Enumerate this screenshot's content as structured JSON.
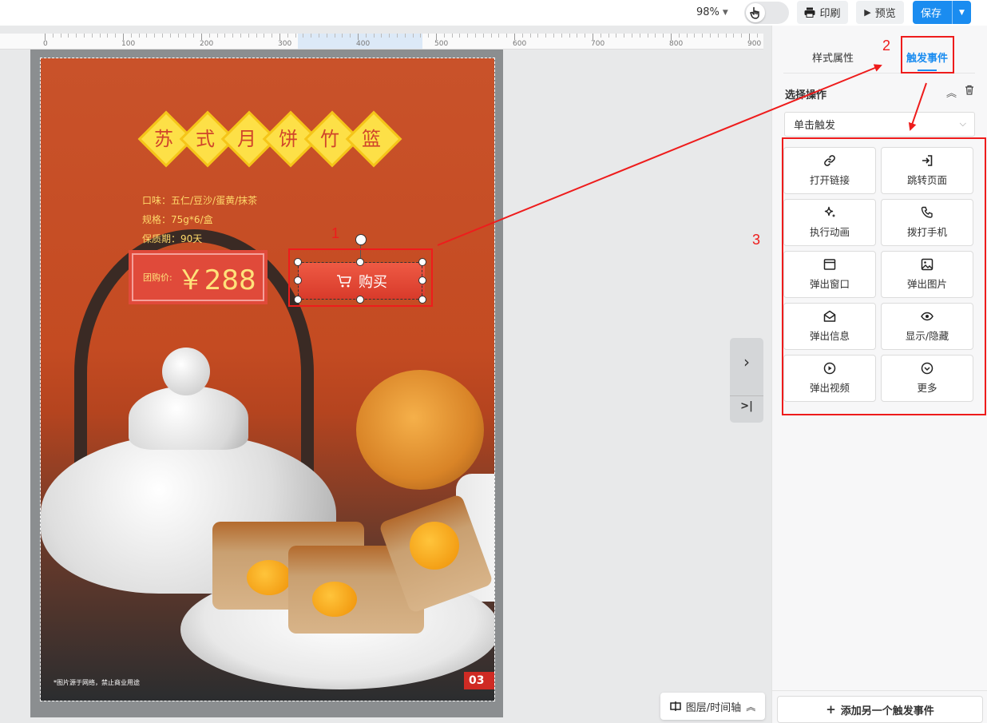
{
  "toolbar": {
    "zoom": "98%",
    "print_label": "印刷",
    "preview_label": "预览",
    "save_label": "保存"
  },
  "ruler": {
    "ticks": [
      "0",
      "100",
      "200",
      "300",
      "400",
      "500",
      "600",
      "700",
      "800",
      "900"
    ]
  },
  "poster": {
    "title_chars": [
      "苏",
      "式",
      "月",
      "饼",
      "竹",
      "篮"
    ],
    "flavor": "口味：五仁/豆沙/蛋黄/抹茶",
    "spec": "规格：75g*6/盒",
    "shelf_life": "保质期：90天",
    "price_label": "团购价:",
    "price_value": "￥288",
    "buy_label": "购买",
    "footnote": "*图片源于网络，禁止商业用途",
    "page_number": "03"
  },
  "annotations": {
    "n1": "1",
    "n2": "2",
    "n3": "3"
  },
  "layers_button": "图层/时间轴",
  "panel": {
    "tab_style": "样式属性",
    "tab_event": "触发事件",
    "section_title": "选择操作",
    "trigger_select": "单击触发",
    "actions": [
      {
        "label": "打开链接",
        "icon": "link-icon"
      },
      {
        "label": "跳转页面",
        "icon": "login-icon"
      },
      {
        "label": "执行动画",
        "icon": "sparkle-icon"
      },
      {
        "label": "拨打手机",
        "icon": "phone-icon"
      },
      {
        "label": "弹出窗口",
        "icon": "window-icon"
      },
      {
        "label": "弹出图片",
        "icon": "image-icon"
      },
      {
        "label": "弹出信息",
        "icon": "mail-icon"
      },
      {
        "label": "显示/隐藏",
        "icon": "eye-icon"
      },
      {
        "label": "弹出视频",
        "icon": "play-icon"
      },
      {
        "label": "更多",
        "icon": "chevron-circle-icon"
      }
    ],
    "add_trigger": "添加另一个触发事件"
  },
  "colors": {
    "accent": "#1a8cf0",
    "annotation_red": "#ee1c1c",
    "poster_orange": "#c44b22",
    "gold": "#fde047"
  }
}
